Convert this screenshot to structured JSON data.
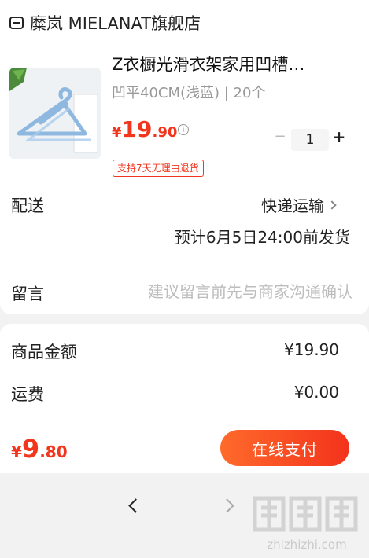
{
  "shop": {
    "name": "糜岚 MIELANAT旗舰店"
  },
  "product": {
    "title": "Z衣橱光滑衣架家用凹槽…",
    "spec": "凹平40CM(浅蓝) | 20个",
    "price_currency": "¥",
    "price_int": "19",
    "price_dec": ".90",
    "quantity": "1",
    "return_badge": "支持7天无理由退货"
  },
  "delivery": {
    "label": "配送",
    "method": "快递运输",
    "eta": "预计6月5日24:00前发货"
  },
  "remark": {
    "label": "留言",
    "placeholder": "建议留言前先与商家沟通确认"
  },
  "summary": {
    "goods_label": "商品金额",
    "goods_value": "¥19.90",
    "shipping_label": "运费",
    "shipping_value": "¥0.00"
  },
  "checkout": {
    "currency": "¥",
    "total_int": "9",
    "total_dec": ".80",
    "pay_label": "在线支付"
  },
  "colors": {
    "accent": "#f2361d",
    "button_gradient_start": "#ff6a2b",
    "button_gradient_end": "#f3331c"
  },
  "watermark": {
    "brand": "值值值",
    "url": "zhizhizhi.com"
  }
}
